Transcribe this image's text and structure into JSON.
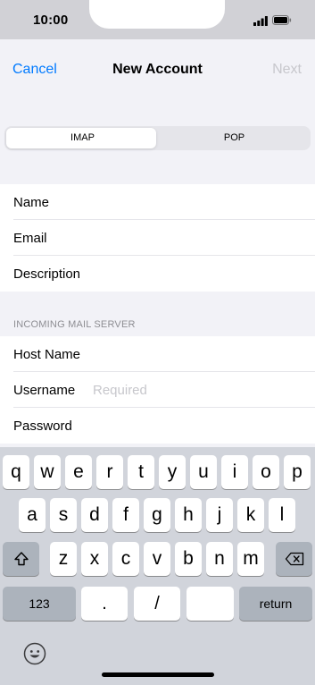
{
  "status_bar": {
    "time": "10:00"
  },
  "nav": {
    "cancel": "Cancel",
    "title": "New Account",
    "next": "Next"
  },
  "segmented": {
    "options": [
      "IMAP",
      "POP"
    ],
    "selected": "IMAP"
  },
  "account_fields": [
    {
      "label": "Name",
      "placeholder": ""
    },
    {
      "label": "Email",
      "placeholder": ""
    },
    {
      "label": "Description",
      "placeholder": ""
    }
  ],
  "incoming_server": {
    "header": "INCOMING MAIL SERVER",
    "fields": [
      {
        "label": "Host Name",
        "placeholder": ""
      },
      {
        "label": "Username",
        "placeholder": "Required"
      },
      {
        "label": "Password",
        "placeholder": ""
      }
    ]
  },
  "keyboard": {
    "row1": [
      "q",
      "w",
      "e",
      "r",
      "t",
      "y",
      "u",
      "i",
      "o",
      "p"
    ],
    "row2": [
      "a",
      "s",
      "d",
      "f",
      "g",
      "h",
      "j",
      "k",
      "l"
    ],
    "row3": [
      "z",
      "x",
      "c",
      "v",
      "b",
      "n",
      "m"
    ],
    "numbers": "123",
    "dot": ".",
    "slash": "/",
    "return": "return",
    "icons": {
      "shift": "shift-icon",
      "delete": "delete-icon",
      "emoji": "emoji-icon"
    }
  },
  "colors": {
    "accent": "#007aff",
    "disabled": "#c7c7cc",
    "background": "#f2f2f7",
    "keyboard": "#d1d4db"
  }
}
